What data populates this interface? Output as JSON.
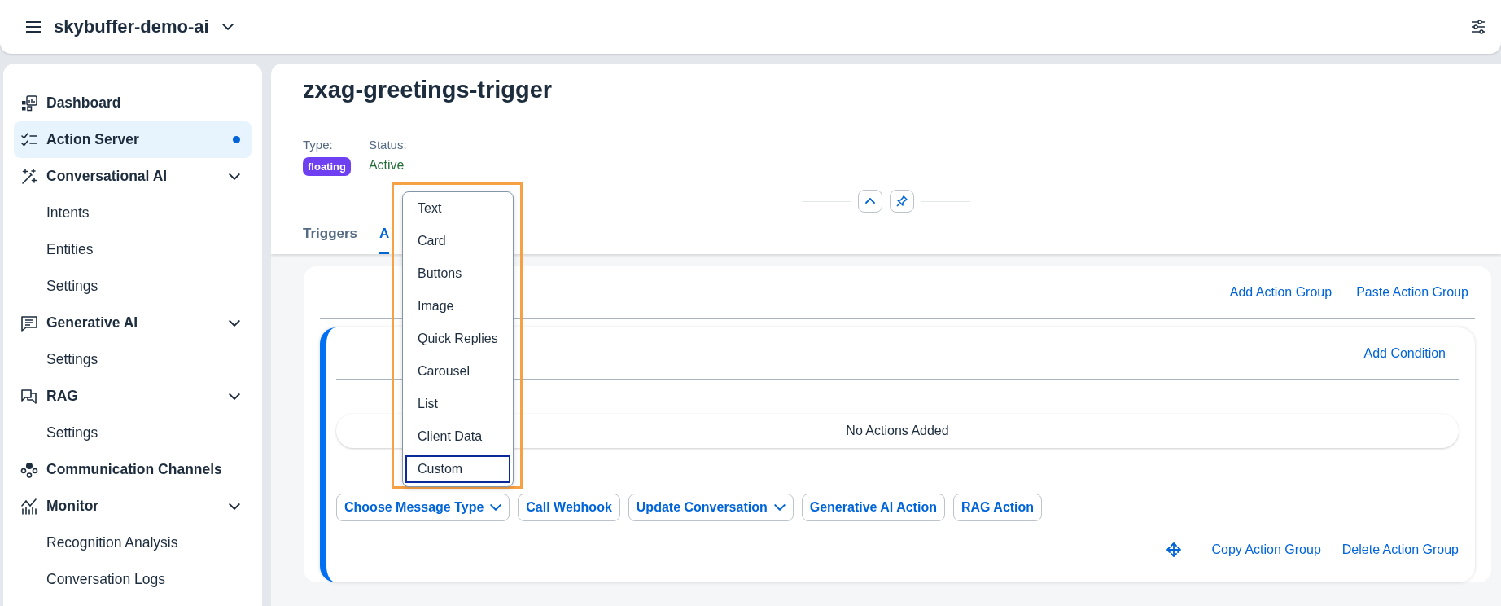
{
  "app_header": {
    "title": "skybuffer-demo-ai"
  },
  "sidebar": {
    "items": [
      {
        "label": "Dashboard",
        "selected": false
      },
      {
        "label": "Action Server",
        "selected": true
      },
      {
        "label": "Conversational AI",
        "selected": false,
        "expanded": true,
        "children": [
          {
            "label": "Intents",
            "selected": false
          },
          {
            "label": "Entities",
            "selected": false
          },
          {
            "label": "Settings",
            "selected": false
          }
        ]
      },
      {
        "label": "Generative AI",
        "selected": false,
        "expanded": true,
        "children": [
          {
            "label": "Settings",
            "selected": false
          }
        ]
      },
      {
        "label": "RAG",
        "selected": false,
        "expanded": true,
        "children": [
          {
            "label": "Settings",
            "selected": false
          }
        ]
      },
      {
        "label": "Communication Channels",
        "selected": false
      },
      {
        "label": "Monitor",
        "selected": false,
        "expanded": true,
        "children": [
          {
            "label": "Recognition Analysis",
            "selected": false
          },
          {
            "label": "Conversation Logs",
            "selected": false
          }
        ]
      }
    ]
  },
  "object_header": {
    "title": "zxag-greetings-trigger",
    "type_label": "Type:",
    "type_value": "floating",
    "status_label": "Status:",
    "status_value": "Active"
  },
  "tabs": [
    {
      "label": "Triggers",
      "selected": false
    },
    {
      "label": "A",
      "selected": true
    }
  ],
  "actions_card": {
    "toolbar_links": [
      "Add Action Group",
      "Paste Action Group"
    ],
    "group": {
      "condition_link": "Add Condition",
      "empty_text": "No Actions Added",
      "buttons": [
        {
          "label": "Choose Message Type",
          "kind": "dropdown"
        },
        {
          "label": "Call Webhook",
          "kind": "button"
        },
        {
          "label": "Update Conversation",
          "kind": "dropdown"
        },
        {
          "label": "Generative AI Action",
          "kind": "button"
        },
        {
          "label": "RAG Action",
          "kind": "button"
        }
      ],
      "footer_links": [
        "Copy Action Group",
        "Delete Action Group"
      ]
    }
  },
  "message_type_menu": {
    "items": [
      {
        "label": "Text",
        "focused": false
      },
      {
        "label": "Card",
        "focused": false
      },
      {
        "label": "Buttons",
        "focused": false
      },
      {
        "label": "Image",
        "focused": false
      },
      {
        "label": "Quick Replies",
        "focused": false
      },
      {
        "label": "Carousel",
        "focused": false
      },
      {
        "label": "List",
        "focused": false
      },
      {
        "label": "Client Data",
        "focused": false
      },
      {
        "label": "Custom",
        "focused": true
      }
    ]
  }
}
